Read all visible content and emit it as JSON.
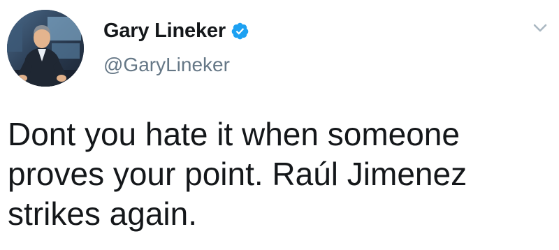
{
  "tweet": {
    "author": {
      "display_name": "Gary Lineker",
      "handle": "@GaryLineker",
      "verified_icon": "verified-badge-icon",
      "avatar": "profile-photo"
    },
    "text": "Dont you hate it when someone\nproves your point. Raúl Jimenez\nstrikes again.",
    "menu_icon": "chevron-down-icon"
  },
  "colors": {
    "text": "#14171a",
    "handle": "#657786",
    "verified": "#1da1f2",
    "chevron": "#aab8c2"
  }
}
